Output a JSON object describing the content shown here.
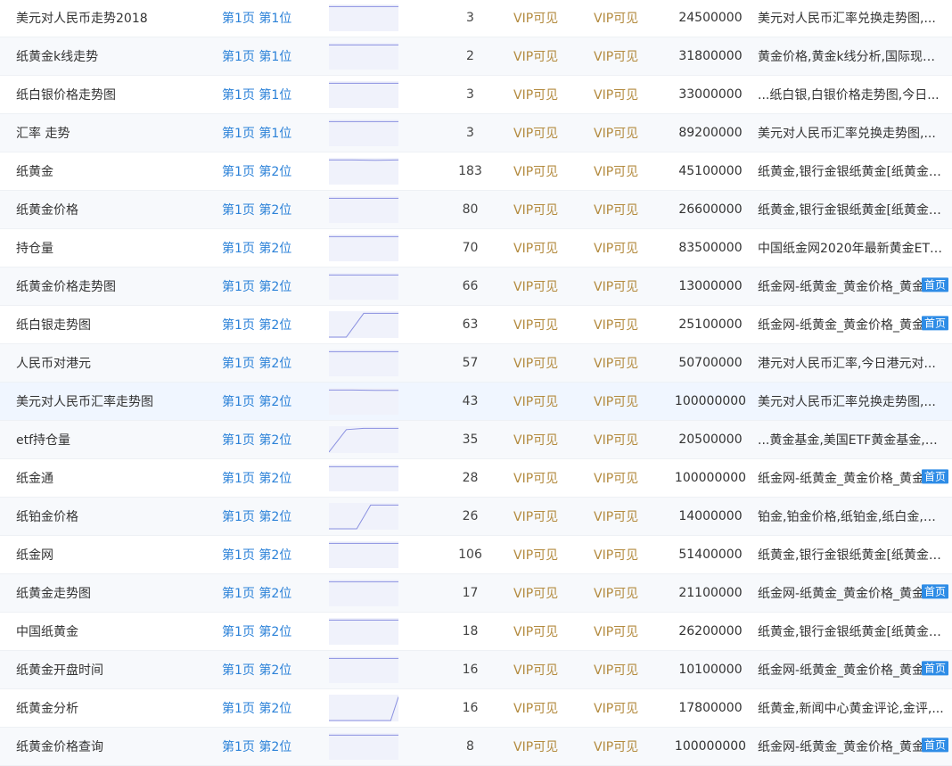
{
  "rows": [
    {
      "keyword": "美元对人民币走势2018",
      "rank_page": "第1页",
      "rank_pos": "第1位",
      "trend": [
        0.05,
        0.05,
        0.05,
        0.05
      ],
      "count": "3",
      "pc": "VIP可见",
      "mobile": "VIP可见",
      "index": "24500000",
      "title": "美元对人民币汇率兑换走势图,...",
      "badge": ""
    },
    {
      "keyword": "纸黄金k线走势",
      "rank_page": "第1页",
      "rank_pos": "第1位",
      "trend": [
        0.05,
        0.05,
        0.05,
        0.05
      ],
      "count": "2",
      "pc": "VIP可见",
      "mobile": "VIP可见",
      "index": "31800000",
      "title": "黄金价格,黄金k线分析,国际现货...",
      "badge": ""
    },
    {
      "keyword": "纸白银价格走势图",
      "rank_page": "第1页",
      "rank_pos": "第1位",
      "trend": [
        0.05,
        0.05,
        0.05,
        0.05
      ],
      "count": "3",
      "pc": "VIP可见",
      "mobile": "VIP可见",
      "index": "33000000",
      "title": "...纸白银,白银价格走势图,今日...",
      "badge": ""
    },
    {
      "keyword": "汇率 走势",
      "rank_page": "第1页",
      "rank_pos": "第1位",
      "trend": [
        0.05,
        0.05,
        0.05,
        0.05
      ],
      "count": "3",
      "pc": "VIP可见",
      "mobile": "VIP可见",
      "index": "89200000",
      "title": "美元对人民币汇率兑换走势图,...",
      "badge": ""
    },
    {
      "keyword": "纸黄金",
      "rank_page": "第1页",
      "rank_pos": "第2位",
      "trend": [
        0.05,
        0.05,
        0.06,
        0.05
      ],
      "count": "183",
      "pc": "VIP可见",
      "mobile": "VIP可见",
      "index": "45100000",
      "title": "纸黄金,银行金银纸黄金[纸黄金[...",
      "badge": ""
    },
    {
      "keyword": "纸黄金价格",
      "rank_page": "第1页",
      "rank_pos": "第2位",
      "trend": [
        0.05,
        0.05,
        0.05,
        0.05
      ],
      "count": "80",
      "pc": "VIP可见",
      "mobile": "VIP可见",
      "index": "26600000",
      "title": "纸黄金,银行金银纸黄金[纸黄金[...",
      "badge": ""
    },
    {
      "keyword": "持仓量",
      "rank_page": "第1页",
      "rank_pos": "第2位",
      "trend": [
        0.05,
        0.05,
        0.05,
        0.05
      ],
      "count": "70",
      "pc": "VIP可见",
      "mobile": "VIP可见",
      "index": "83500000",
      "title": "中国纸金网2020年最新黄金ETF...",
      "badge": ""
    },
    {
      "keyword": "纸黄金价格走势图",
      "rank_page": "第1页",
      "rank_pos": "第2位",
      "trend": [
        0.05,
        0.05,
        0.05,
        0.05
      ],
      "count": "66",
      "pc": "VIP可见",
      "mobile": "VIP可见",
      "index": "13000000",
      "title": "纸金网-纸黄金_黄金价格_黄金",
      "badge": "首页"
    },
    {
      "keyword": "纸白银走势图",
      "rank_page": "第1页",
      "rank_pos": "第2位",
      "trend": [
        1,
        1,
        0.05,
        0.05,
        0.05
      ],
      "count": "63",
      "pc": "VIP可见",
      "mobile": "VIP可见",
      "index": "25100000",
      "title": "纸金网-纸黄金_黄金价格_黄金",
      "badge": "首页"
    },
    {
      "keyword": "人民币对港元",
      "rank_page": "第1页",
      "rank_pos": "第2位",
      "trend": [
        0.05,
        0.05,
        0.05,
        0.05
      ],
      "count": "57",
      "pc": "VIP可见",
      "mobile": "VIP可见",
      "index": "50700000",
      "title": "港元对人民币汇率,今日港元对...",
      "badge": ""
    },
    {
      "keyword": "美元对人民币汇率走势图",
      "rank_page": "第1页",
      "rank_pos": "第2位",
      "trend": [
        0.05,
        0.05,
        0.06,
        0.06
      ],
      "count": "43",
      "pc": "VIP可见",
      "mobile": "VIP可见",
      "index": "100000000",
      "title": "美元对人民币汇率兑换走势图,...",
      "badge": ""
    },
    {
      "keyword": "etf持仓量",
      "rank_page": "第1页",
      "rank_pos": "第2位",
      "trend": [
        1,
        0.1,
        0.05,
        0.05,
        0.05
      ],
      "count": "35",
      "pc": "VIP可见",
      "mobile": "VIP可见",
      "index": "20500000",
      "title": "...黄金基金,美国ETF黄金基金,白...",
      "badge": ""
    },
    {
      "keyword": "纸金通",
      "rank_page": "第1页",
      "rank_pos": "第2位",
      "trend": [
        0.05,
        0.05,
        0.05,
        0.05
      ],
      "count": "28",
      "pc": "VIP可见",
      "mobile": "VIP可见",
      "index": "100000000",
      "title": "纸金网-纸黄金_黄金价格_黄金",
      "badge": "首页"
    },
    {
      "keyword": "纸铂金价格",
      "rank_page": "第1页",
      "rank_pos": "第2位",
      "trend": [
        1,
        1,
        1,
        0.05,
        0.05,
        0.05
      ],
      "count": "26",
      "pc": "VIP可见",
      "mobile": "VIP可见",
      "index": "14000000",
      "title": "铂金,铂金价格,纸铂金,纸白金,白...",
      "badge": ""
    },
    {
      "keyword": "纸金网",
      "rank_page": "第1页",
      "rank_pos": "第2位",
      "trend": [
        0.05,
        0.05,
        0.05,
        0.05
      ],
      "count": "106",
      "pc": "VIP可见",
      "mobile": "VIP可见",
      "index": "51400000",
      "title": "纸黄金,银行金银纸黄金[纸黄金[...",
      "badge": ""
    },
    {
      "keyword": "纸黄金走势图",
      "rank_page": "第1页",
      "rank_pos": "第2位",
      "trend": [
        0.05,
        0.05,
        0.05,
        0.05
      ],
      "count": "17",
      "pc": "VIP可见",
      "mobile": "VIP可见",
      "index": "21100000",
      "title": "纸金网-纸黄金_黄金价格_黄金",
      "badge": "首页"
    },
    {
      "keyword": "中国纸黄金",
      "rank_page": "第1页",
      "rank_pos": "第2位",
      "trend": [
        0.05,
        0.05,
        0.05,
        0.05
      ],
      "count": "18",
      "pc": "VIP可见",
      "mobile": "VIP可见",
      "index": "26200000",
      "title": "纸黄金,银行金银纸黄金[纸黄金[...",
      "badge": ""
    },
    {
      "keyword": "纸黄金开盘时间",
      "rank_page": "第1页",
      "rank_pos": "第2位",
      "trend": [
        0.05,
        0.05,
        0.05,
        0.05
      ],
      "count": "16",
      "pc": "VIP可见",
      "mobile": "VIP可见",
      "index": "10100000",
      "title": "纸金网-纸黄金_黄金价格_黄金",
      "badge": "首页"
    },
    {
      "keyword": "纸黄金分析",
      "rank_page": "第1页",
      "rank_pos": "第2位",
      "trend": [
        1,
        1,
        1,
        1,
        1,
        1,
        1,
        1,
        1,
        0.05
      ],
      "count": "16",
      "pc": "VIP可见",
      "mobile": "VIP可见",
      "index": "17800000",
      "title": "纸黄金,新闻中心黄金评论,金评,...",
      "badge": ""
    },
    {
      "keyword": "纸黄金价格查询",
      "rank_page": "第1页",
      "rank_pos": "第2位",
      "trend": [
        0.05,
        0.05,
        0.05,
        0.05
      ],
      "count": "8",
      "pc": "VIP可见",
      "mobile": "VIP可见",
      "index": "100000000",
      "title": "纸金网-纸黄金_黄金价格_黄金",
      "badge": "首页"
    }
  ],
  "colors": {
    "link": "#2c82d8",
    "vip": "#b38a3e",
    "badge": "#2e8ce6",
    "spark_bg": "#f0f2fb",
    "spark_line": "#8a90e0"
  }
}
